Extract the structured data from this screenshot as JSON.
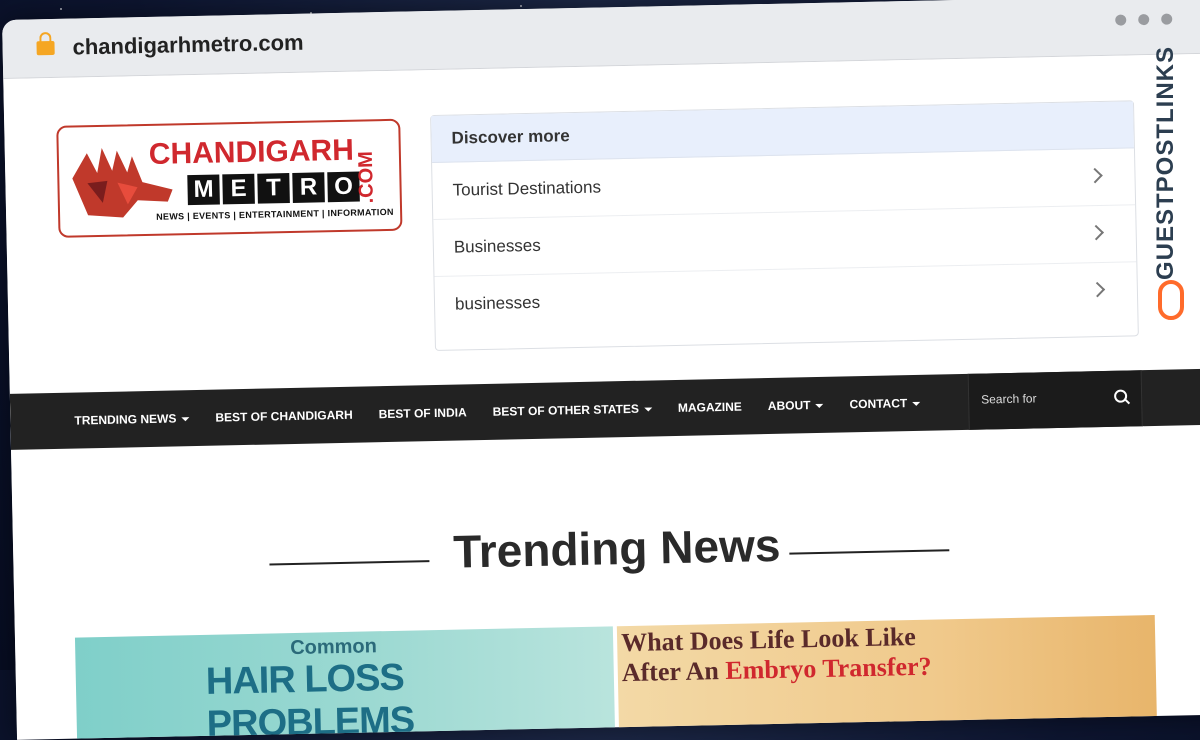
{
  "browser": {
    "url": "chandigarhmetro.com"
  },
  "logo": {
    "line1": "CHANDIGARH",
    "metro": [
      "M",
      "E",
      "T",
      "R",
      "O"
    ],
    "com": ".COM",
    "tagline": "NEWS | EVENTS | ENTERTAINMENT | INFORMATION"
  },
  "discover": {
    "title": "Discover more",
    "items": [
      "Tourist Destinations",
      "Businesses",
      "businesses"
    ]
  },
  "watermark": {
    "text": "GUESTPOSTLINKS"
  },
  "nav": {
    "items": [
      {
        "label": "TRENDING NEWS",
        "caret": true
      },
      {
        "label": "BEST OF CHANDIGARH",
        "caret": false
      },
      {
        "label": "BEST OF INDIA",
        "caret": false
      },
      {
        "label": "BEST OF OTHER STATES",
        "caret": true
      },
      {
        "label": "MAGAZINE",
        "caret": false
      },
      {
        "label": "ABOUT",
        "caret": true
      },
      {
        "label": "CONTACT",
        "caret": true
      }
    ],
    "search_placeholder": "Search for"
  },
  "trending": {
    "title": "Trending News",
    "cards": [
      {
        "line1": "Common",
        "line2": "HAIR LOSS PROBLEMS"
      },
      {
        "line1": "What Does Life Look Like",
        "line2_a": "After An ",
        "line2_b": "Embryo Transfer?"
      }
    ]
  },
  "colors": {
    "brand_red": "#d0282e",
    "nav_bg": "#222222",
    "discover_head_bg": "#e8effc",
    "watermark_orange": "#ff6b2b"
  }
}
